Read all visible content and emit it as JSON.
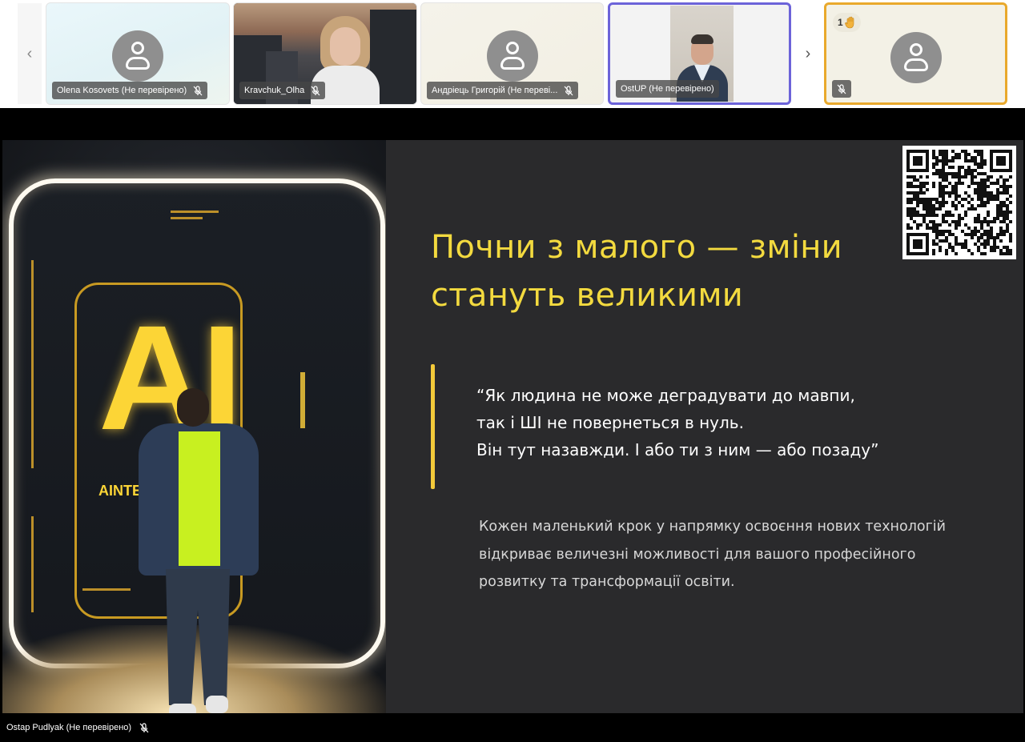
{
  "participants": [
    {
      "name": "Olena Kosovets (Не перевірено)",
      "type": "avatar"
    },
    {
      "name": "Kravchuk_Olha",
      "type": "video"
    },
    {
      "name": "Андріець Григорій (Не переві...",
      "type": "avatar"
    },
    {
      "name": "OstUP (Не перевірено)",
      "type": "video"
    },
    {
      "name": "",
      "type": "avatar",
      "raised_hands": "1"
    }
  ],
  "nav": {
    "prev_icon": "‹",
    "next_icon": "›"
  },
  "colors": {
    "active_speaker_border": "#6c63d9",
    "hand_raised_border": "#e9a92c",
    "slide_accent": "#f3da3f"
  },
  "slide": {
    "image_text": {
      "big": "AI",
      "small": "AINTE"
    },
    "title_line1": "Почни з малого — зміни",
    "title_line2": "стануть великими",
    "quote_line1": "“Як людина не може деградувати до мавпи,",
    "quote_line2": "так і ШІ не повернеться в нуль.",
    "quote_line3": "Він тут назавжди. І або ти з ним — або позаду”",
    "body_line1": "Кожен маленький крок у напрямку освоєння нових технологій",
    "body_line2": "відкриває величезні можливості для вашого професійного",
    "body_line3": "розвитку та трансформації освіти."
  },
  "presenter": {
    "name": "Ostap Pudlyak (Не перевірено)"
  }
}
